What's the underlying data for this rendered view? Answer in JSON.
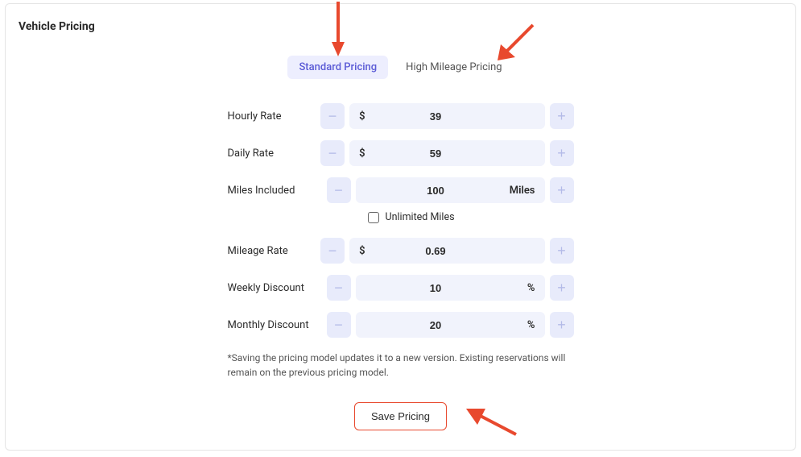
{
  "section_title": "Vehicle Pricing",
  "tabs": {
    "standard": "Standard Pricing",
    "high_mileage": "High Mileage Pricing"
  },
  "fields": {
    "hourly_rate": {
      "label": "Hourly Rate",
      "prefix": "$",
      "value": "39",
      "suffix": ""
    },
    "daily_rate": {
      "label": "Daily Rate",
      "prefix": "$",
      "value": "59",
      "suffix": ""
    },
    "miles_included": {
      "label": "Miles Included",
      "prefix": "",
      "value": "100",
      "suffix": "Miles"
    },
    "unlimited_miles": {
      "label": "Unlimited Miles"
    },
    "mileage_rate": {
      "label": "Mileage Rate",
      "prefix": "$",
      "value": "0.69",
      "suffix": ""
    },
    "weekly_discount": {
      "label": "Weekly Discount",
      "prefix": "",
      "value": "10",
      "suffix": "%"
    },
    "monthly_discount": {
      "label": "Monthly Discount",
      "prefix": "",
      "value": "20",
      "suffix": "%"
    }
  },
  "note": "*Saving the pricing model updates it to a new version. Existing reservations will remain on the previous pricing model.",
  "save_button": "Save Pricing"
}
